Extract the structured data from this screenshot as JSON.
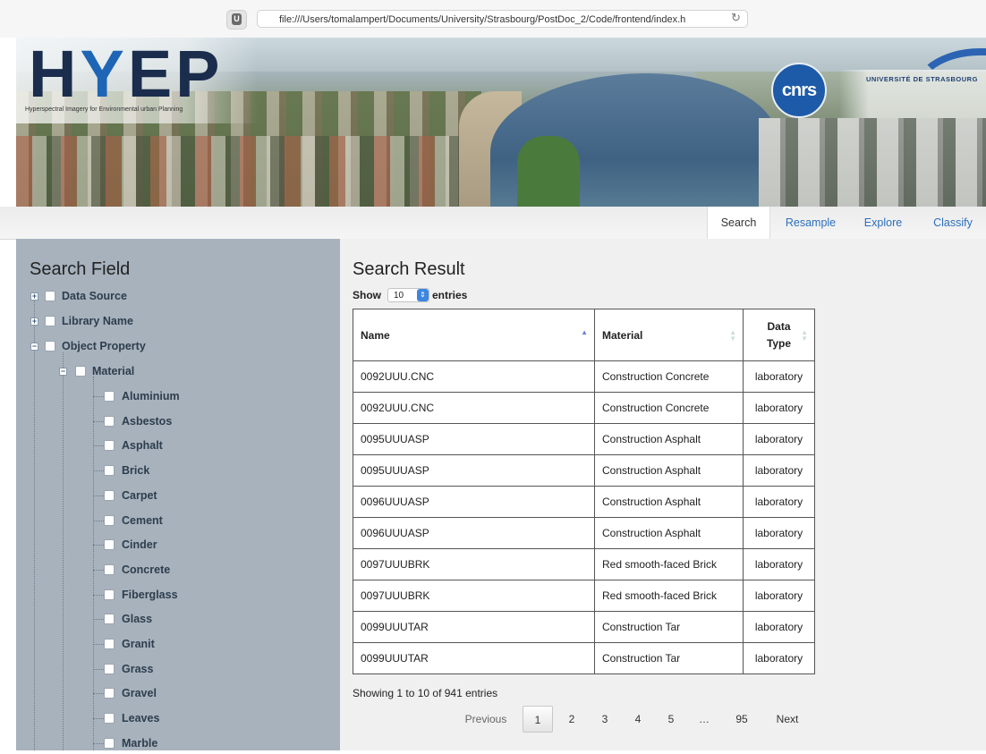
{
  "browser": {
    "url": "file:///Users/tomalampert/Documents/University/Strasbourg/PostDoc_2/Code/frontend/index.h",
    "extension_label": "U"
  },
  "banner": {
    "logo_text_a": "H",
    "logo_text_y": "Y",
    "logo_text_b": "EP",
    "logo_tagline": "Hyperspectral Imagery for Environmental urban Planning",
    "cnrs_logo": "cnrs",
    "university_logo": "UNIVERSITÉ DE STRASBOURG"
  },
  "nav": {
    "tabs": [
      {
        "label": "Search",
        "active": true
      },
      {
        "label": "Resample",
        "active": false
      },
      {
        "label": "Explore",
        "active": false
      },
      {
        "label": "Classify",
        "active": false
      }
    ]
  },
  "search_field": {
    "title": "Search Field",
    "top_items": [
      "Data Source",
      "Library Name",
      "Object Property"
    ],
    "material_label": "Material",
    "materials": [
      "Aluminium",
      "Asbestos",
      "Asphalt",
      "Brick",
      "Carpet",
      "Cement",
      "Cinder",
      "Concrete",
      "Fiberglass",
      "Glass",
      "Granit",
      "Grass",
      "Gravel",
      "Leaves",
      "Marble"
    ]
  },
  "search_result": {
    "title": "Search Result",
    "show_label": "Show",
    "entries_value": "10",
    "entries_label": "entries",
    "columns": [
      "Name",
      "Material",
      "Data Type"
    ],
    "rows": [
      [
        "0092UUU.CNC",
        "Construction Concrete",
        "laboratory"
      ],
      [
        "0092UUU.CNC",
        "Construction Concrete",
        "laboratory"
      ],
      [
        "0095UUUASP",
        "Construction Asphalt",
        "laboratory"
      ],
      [
        "0095UUUASP",
        "Construction Asphalt",
        "laboratory"
      ],
      [
        "0096UUUASP",
        "Construction Asphalt",
        "laboratory"
      ],
      [
        "0096UUUASP",
        "Construction Asphalt",
        "laboratory"
      ],
      [
        "0097UUUBRK",
        "Red smooth-faced Brick",
        "laboratory"
      ],
      [
        "0097UUUBRK",
        "Red smooth-faced Brick",
        "laboratory"
      ],
      [
        "0099UUUTAR",
        "Construction Tar",
        "laboratory"
      ],
      [
        "0099UUUTAR",
        "Construction Tar",
        "laboratory"
      ]
    ],
    "info": "Showing 1 to 10 of 941 entries",
    "pagination": {
      "previous": "Previous",
      "pages": [
        "1",
        "2",
        "3",
        "4",
        "5"
      ],
      "ellipsis": "…",
      "last": "95",
      "next": "Next",
      "current": "1"
    }
  },
  "colors": {
    "link": "#2c6fbd",
    "left_panel": "#a7b2bd",
    "main_bg": "#f0f0f0",
    "sort_asc": "#6c7fd8",
    "select_arrow": "#3d86e0"
  }
}
